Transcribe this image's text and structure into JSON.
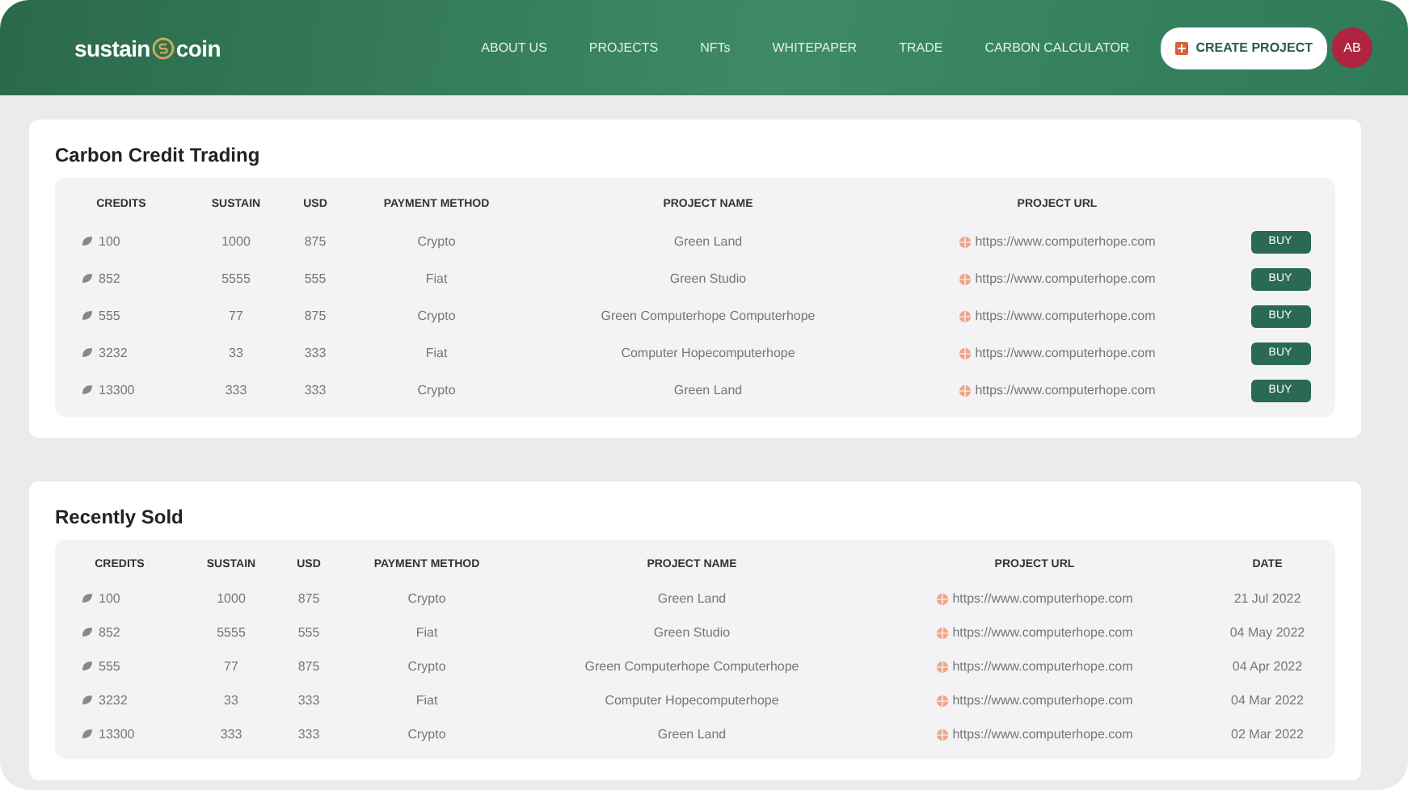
{
  "header": {
    "logo": {
      "left": "sustain",
      "right": "coin"
    },
    "nav": [
      {
        "label": "ABOUT US",
        "selected": false
      },
      {
        "label": "PROJECTS",
        "selected": false
      },
      {
        "label": "NFTs",
        "selected": false
      },
      {
        "label": "WHITEPAPER",
        "selected": false
      },
      {
        "label": "TRADE",
        "selected": false
      },
      {
        "label": "CARBON CALCULATOR",
        "selected": false
      }
    ],
    "cta": "CREATE PROJECT",
    "avatar": "AB"
  },
  "sections": [
    {
      "title": "Carbon Credit Trading",
      "kind": "trading",
      "columns": [
        "CREDITS",
        "SUSTAIN",
        "USD",
        "PAYMENT METHOD",
        "PROJECT NAME",
        "PROJECT URL"
      ],
      "rows": [
        {
          "credits": "100",
          "sustain": "1000",
          "usd": "875",
          "payment": "Crypto",
          "project": "Green Land",
          "url": "https://www.computerhope.com",
          "action": "BUY"
        },
        {
          "credits": "852",
          "sustain": "5555",
          "usd": "555",
          "payment": "Fiat",
          "project": "Green Studio",
          "url": "https://www.computerhope.com",
          "action": "BUY"
        },
        {
          "credits": "555",
          "sustain": "77",
          "usd": "875",
          "payment": "Crypto",
          "project": "Green Computerhope Computerhope",
          "url": "https://www.computerhope.com",
          "action": "BUY"
        },
        {
          "credits": "3232",
          "sustain": "33",
          "usd": "333",
          "payment": "Fiat",
          "project": "Computer Hopecomputerhope",
          "url": "https://www.computerhope.com",
          "action": "BUY"
        },
        {
          "credits": "13300",
          "sustain": "333",
          "usd": "333",
          "payment": "Crypto",
          "project": "Green Land",
          "url": "https://www.computerhope.com",
          "action": "BUY"
        }
      ]
    },
    {
      "title": "Recently Sold",
      "kind": "sold",
      "columns": [
        "CREDITS",
        "SUSTAIN",
        "USD",
        "PAYMENT METHOD",
        "PROJECT NAME",
        "PROJECT URL",
        "DATE"
      ],
      "rows": [
        {
          "credits": "100",
          "sustain": "1000",
          "usd": "875",
          "payment": "Crypto",
          "project": "Green Land",
          "url": "https://www.computerhope.com",
          "date": "21 Jul 2022"
        },
        {
          "credits": "852",
          "sustain": "5555",
          "usd": "555",
          "payment": "Fiat",
          "project": "Green Studio",
          "url": "https://www.computerhope.com",
          "date": "04 May 2022"
        },
        {
          "credits": "555",
          "sustain": "77",
          "usd": "875",
          "payment": "Crypto",
          "project": "Green Computerhope Computerhope",
          "url": "https://www.computerhope.com",
          "date": "04 Apr 2022"
        },
        {
          "credits": "3232",
          "sustain": "33",
          "usd": "333",
          "payment": "Fiat",
          "project": "Computer Hopecomputerhope",
          "url": "https://www.computerhope.com",
          "date": "04 Mar 2022"
        },
        {
          "credits": "13300",
          "sustain": "333",
          "usd": "333",
          "payment": "Crypto",
          "project": "Green Land",
          "url": "https://www.computerhope.com",
          "date": "02 Mar 2022"
        }
      ]
    }
  ]
}
